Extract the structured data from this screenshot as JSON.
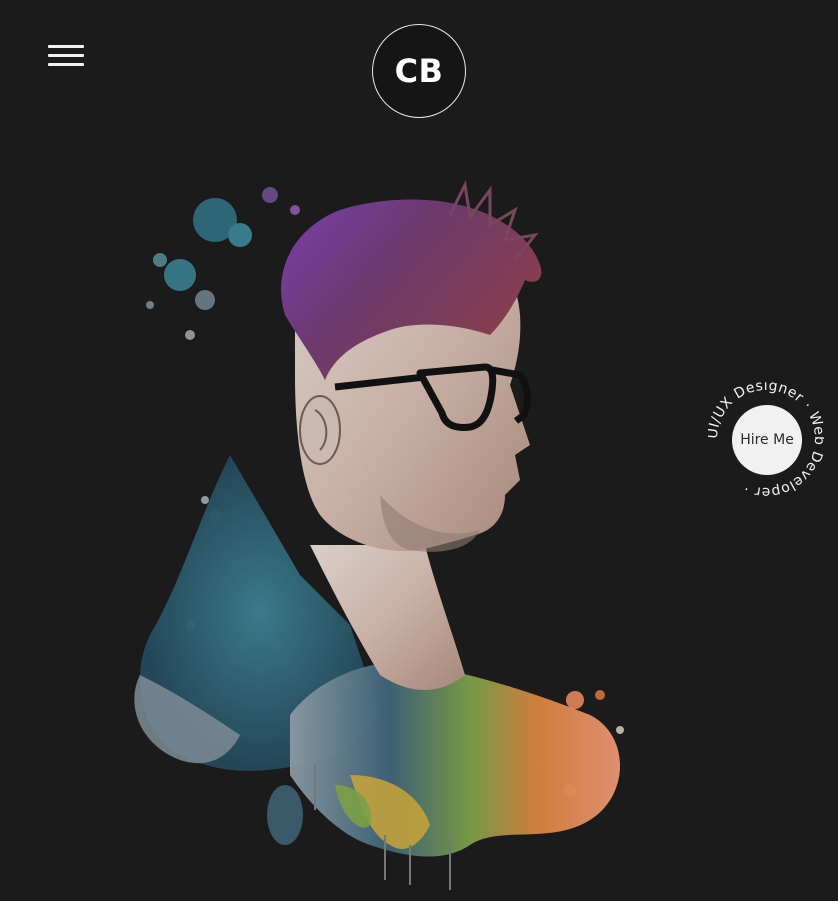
{
  "header": {
    "logo_text": "CB"
  },
  "hire_badge": {
    "button_label": "Hire Me",
    "ring_text": "UI/UX Designer · Web Developer ·"
  },
  "colors": {
    "background": "#1b1b1b",
    "foreground": "#f2f2f2"
  }
}
